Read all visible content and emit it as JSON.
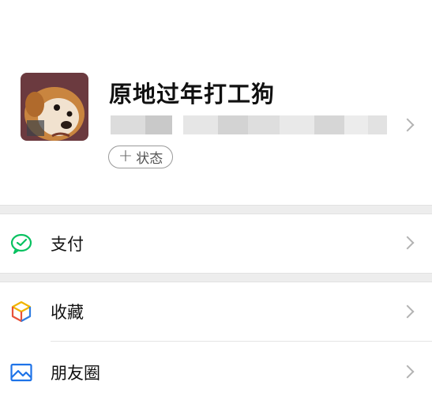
{
  "profile": {
    "nickname": "原地过年打工狗",
    "status_button_plus": "+",
    "status_button_label": "状态"
  },
  "menu": {
    "pay": {
      "label": "支付",
      "icon": "wechat-pay-icon"
    },
    "favorites": {
      "label": "收藏",
      "icon": "favorites-cube-icon"
    },
    "moments": {
      "label": "朋友圈",
      "icon": "moments-photo-icon"
    }
  },
  "colors": {
    "background": "#ffffff",
    "separator": "#ededed",
    "pay_green": "#07c160",
    "moments_blue": "#1e73e8",
    "chevron_gray": "#b3b3b3"
  }
}
